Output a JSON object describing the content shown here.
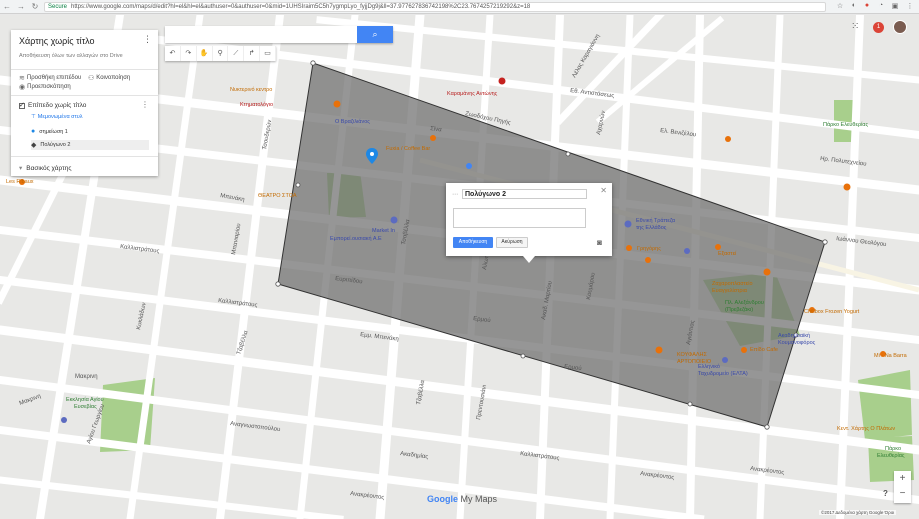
{
  "browser": {
    "secure_label": "Secure",
    "url": "https://www.google.com/maps/d/edit?hl=el&hl=el&authuser=0&authuser=0&mid=1UHSIraim5C5h7ygmpLyo_fyjjDg9j&ll=37.977627836742198%2C23.7674257219292&z=18"
  },
  "panel": {
    "map_title": "Χάρτης χωρίς τίτλο",
    "subtitle": "Αποθήκευση όλων των αλλαγών στο Drive",
    "add_layer": "Προσθήκη επιπέδου",
    "share": "Κοινοποίηση",
    "preview": "Προεπισκόπηση",
    "layer_name": "Επίπεδο χωρίς τίτλο",
    "style_link": "Μεμονωμένα στυλ",
    "features": [
      "σημείωση 1",
      "Πολύγωνο 2"
    ],
    "basemap": "Βασικός χάρτης"
  },
  "search": {
    "placeholder": ""
  },
  "popup": {
    "title_value": "Πολύγωνο 2",
    "save": "Αποθήκευση",
    "cancel": "Ακύρωση"
  },
  "controls": {
    "badge": "1",
    "zoom_in": "+",
    "zoom_out": "−",
    "help": "?"
  },
  "footer": {
    "logo_google": "Google",
    "logo_mymaps": "My Maps",
    "copyright": "©2017 Δεδομένα χάρτη Google   Όροι"
  },
  "map_labels": {
    "streets": [
      "Ιπποκράτους",
      "Σόλωνος",
      "Ακαδημίας",
      "Πανεπιστημίου",
      "Σταδίου",
      "Καλλιδρομίου",
      "Καλλιστράτους",
      "Αραχώβης",
      "Εμμ. Μπενάκη",
      "Ζωοδόχου Πηγής",
      "Εμμ. Μπενάκη",
      "Χαριλάου Τρικούπη",
      "Σίνα",
      "Μαυρομιχάλη",
      "Λ. Βασ. Κωνσταντίνου",
      "Αναγνωστοπούλου",
      "Κανάρη",
      "Μασσαλίας",
      "Ομήρου",
      "Βαλαωρίτου",
      "Τζαβέλλα",
      "Ευριπίδου",
      "Ερμού",
      "Εθνικής Αντιστάσεως"
    ],
    "places": [
      "Ο Βραζιλιάνος",
      "Market In",
      "Εμπορεί.ουσιακή Α.Ε",
      "Fuxia / Coffee Bar",
      "Εθνική Τράπεζα της Ελλάδος",
      "Γρηγόρης",
      "Ζαχαροπλαστείο Ευαγγελίστρια",
      "Chillbox Frozen Yogurt",
      "Εκλησία Αγίου Ευσεβίας",
      "ΚΟΥΦΑΛΗΣ ΑΡΤΟΠΟΙΕΙΟ",
      "Ελληνικό Ταχυδρομείο (ΕΛΤΑ)",
      "Επίδο Cafe",
      "Ακάδημα τής Κουμανοφόρος",
      "Καραμάνης Αντώνης",
      "Κτηματολόγιο",
      "Νυκτερινό κεντρο",
      "Les Ribaux",
      "Mi · Na Barra",
      "Κεντ. Χάρτης Ο Πλάτων",
      "Πάρκο Ελευθερίας"
    ]
  }
}
